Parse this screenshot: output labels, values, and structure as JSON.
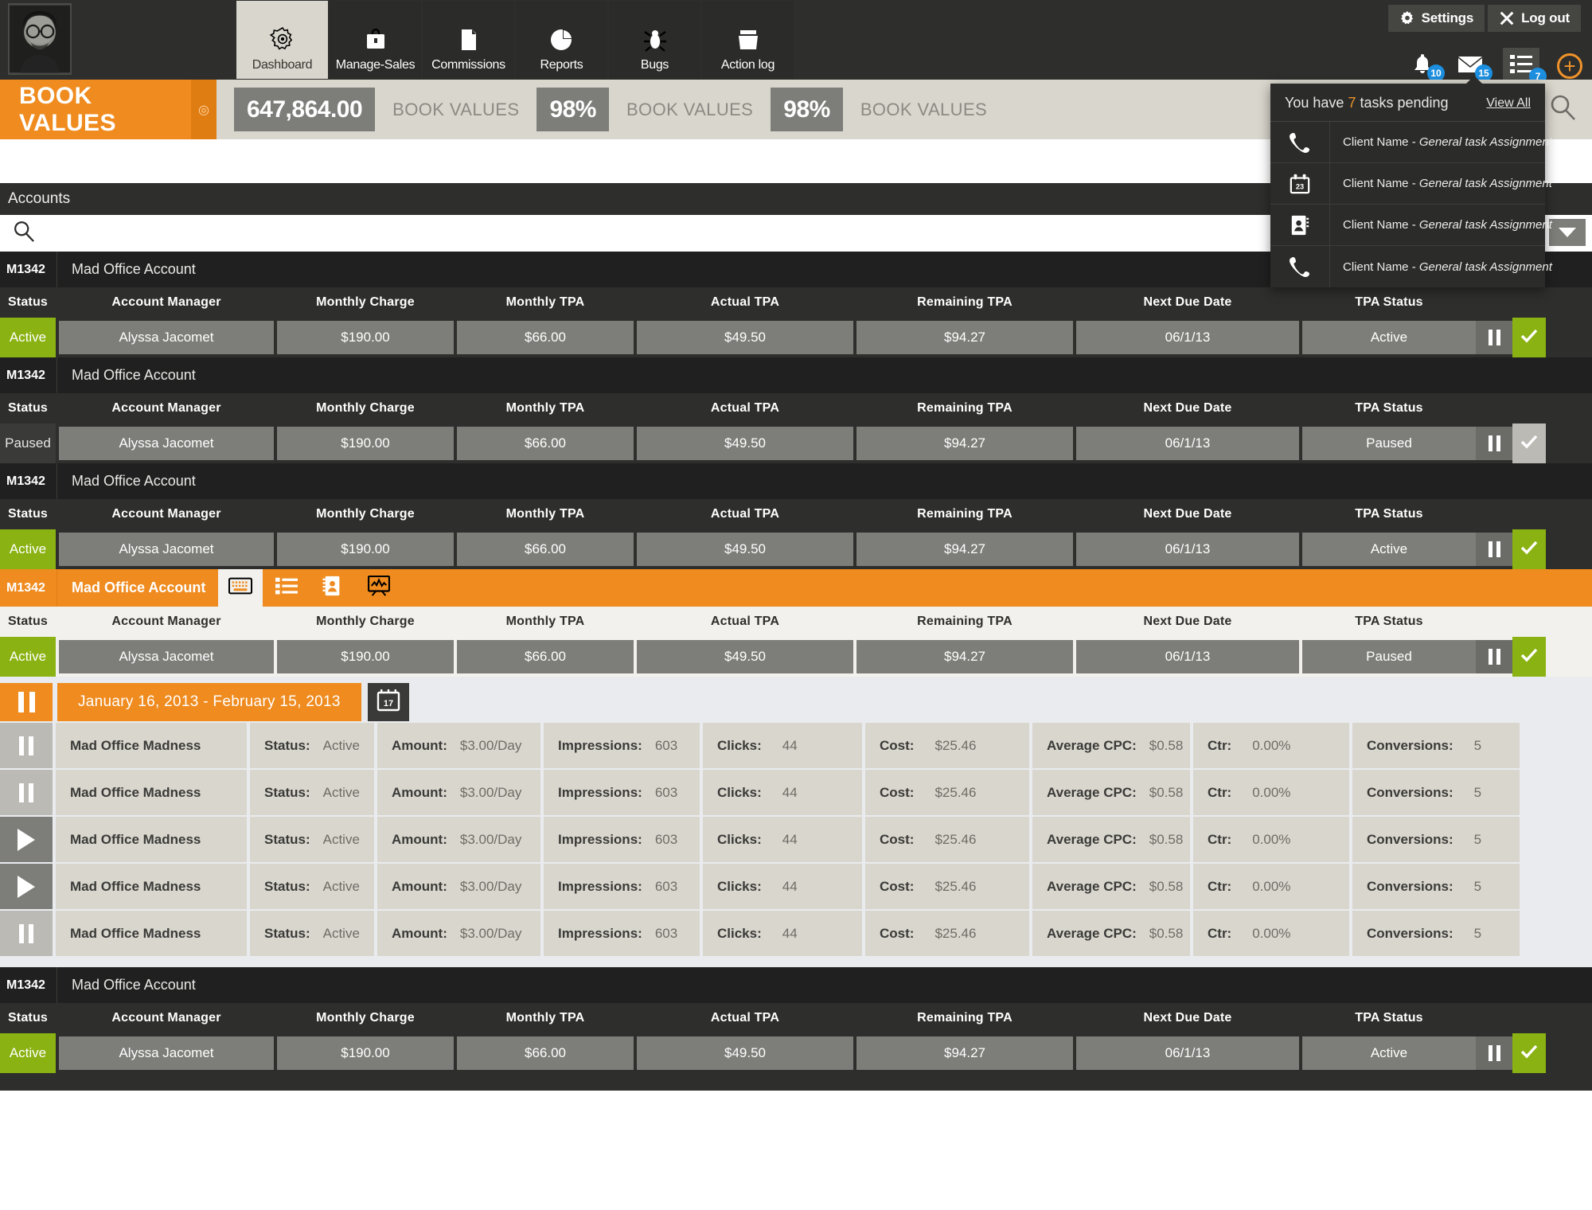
{
  "topnav": {
    "avatar_alt": "user-avatar",
    "tabs": [
      {
        "label": "Dashboard",
        "icon": "gear-icon",
        "active": true
      },
      {
        "label": "Manage-Sales",
        "icon": "briefcase-icon",
        "active": false
      },
      {
        "label": "Commissions",
        "icon": "document-icon",
        "active": false
      },
      {
        "label": "Reports",
        "icon": "pie-chart-icon",
        "active": false
      },
      {
        "label": "Bugs",
        "icon": "bug-icon",
        "active": false
      },
      {
        "label": "Action log",
        "icon": "folder-icon",
        "active": false
      }
    ],
    "settings_label": "Settings",
    "logout_label": "Log out",
    "notifications": {
      "bell_count": "10",
      "mail_count": "15",
      "tasks_count": "7"
    },
    "add_label": "+"
  },
  "tasks_panel": {
    "heading_prefix": "You have",
    "count": "7",
    "heading_suffix": "tasks pending",
    "view_all": "View All",
    "items": [
      {
        "icon": "phone-icon",
        "client": "Client Name - ",
        "task": "General task Assignment"
      },
      {
        "icon": "calendar-icon",
        "client": "Client Name - ",
        "task": "General task Assignment"
      },
      {
        "icon": "contact-book-icon",
        "client": "Client Name - ",
        "task": "General task Assignment"
      },
      {
        "icon": "phone-icon",
        "client": "Client Name - ",
        "task": "General task Assignment"
      }
    ]
  },
  "kpi_strip": {
    "title": "BOOK VALUES",
    "items": [
      {
        "value": "647,864.00",
        "label": "BOOK VALUES"
      },
      {
        "value": "98%",
        "label": "BOOK VALUES"
      },
      {
        "value": "98%",
        "label": "BOOK VALUES"
      }
    ]
  },
  "accounts_section": {
    "heading": "Accounts",
    "search_placeholder": "",
    "search_value": ""
  },
  "columns": [
    "Status",
    "Account Manager",
    "Monthly Charge",
    "Monthly TPA",
    "Actual TPA",
    "Remaining TPA",
    "Next Due Date",
    "TPA Status"
  ],
  "accounts": [
    {
      "code": "M1342",
      "name": "Mad Office Account",
      "selected": false,
      "status": "Active",
      "manager": "Alyssa Jacomet",
      "monthly_charge": "$190.00",
      "monthly_tpa": "$66.00",
      "actual_tpa": "$49.50",
      "remaining_tpa": "$94.27",
      "next_due": "06/1/13",
      "tpa_status": "Active",
      "check_green": true
    },
    {
      "code": "M1342",
      "name": "Mad Office Account",
      "selected": false,
      "status": "Paused",
      "manager": "Alyssa Jacomet",
      "monthly_charge": "$190.00",
      "monthly_tpa": "$66.00",
      "actual_tpa": "$49.50",
      "remaining_tpa": "$94.27",
      "next_due": "06/1/13",
      "tpa_status": "Paused",
      "check_green": false
    },
    {
      "code": "M1342",
      "name": "Mad Office Account",
      "selected": false,
      "status": "Active",
      "manager": "Alyssa Jacomet",
      "monthly_charge": "$190.00",
      "monthly_tpa": "$66.00",
      "actual_tpa": "$49.50",
      "remaining_tpa": "$94.27",
      "next_due": "06/1/13",
      "tpa_status": "Active",
      "check_green": true
    },
    {
      "code": "M1342",
      "name": "Mad Office Account",
      "selected": true,
      "status": "Active",
      "manager": "Alyssa Jacomet",
      "monthly_charge": "$190.00",
      "monthly_tpa": "$66.00",
      "actual_tpa": "$49.50",
      "remaining_tpa": "$94.27",
      "next_due": "06/1/13",
      "tpa_status": "Paused",
      "check_green": true
    },
    {
      "code": "M1342",
      "name": "Mad Office Account",
      "selected": false,
      "status": "Active",
      "manager": "Alyssa Jacomet",
      "monthly_charge": "$190.00",
      "monthly_tpa": "$66.00",
      "actual_tpa": "$49.50",
      "remaining_tpa": "$94.27",
      "next_due": "06/1/13",
      "tpa_status": "Active",
      "check_green": true
    }
  ],
  "account_tabs": [
    {
      "icon": "keyboard-icon",
      "active": true
    },
    {
      "icon": "list-icon",
      "active": false
    },
    {
      "icon": "contact-card-icon",
      "active": false
    },
    {
      "icon": "analytics-icon",
      "active": false
    }
  ],
  "campaign_panel": {
    "date_range": "January 16, 2013 - February 15, 2013",
    "calendar_icon": "calendar-17-icon",
    "labels": {
      "status": "Status:",
      "amount": "Amount:",
      "impressions": "Impressions:",
      "clicks": "Clicks:",
      "cost": "Cost:",
      "avg_cpc": "Average CPC:",
      "ctr": "Ctr:",
      "conversions": "Conversions:"
    },
    "rows": [
      {
        "toggle": "pause",
        "name": "Mad Office Madness",
        "status": "Active",
        "amount": "$3.00/Day",
        "impressions": "603",
        "clicks": "44",
        "cost": "$25.46",
        "avg_cpc": "$0.58",
        "ctr": "0.00%",
        "conversions": "5"
      },
      {
        "toggle": "pause",
        "name": "Mad Office Madness",
        "status": "Active",
        "amount": "$3.00/Day",
        "impressions": "603",
        "clicks": "44",
        "cost": "$25.46",
        "avg_cpc": "$0.58",
        "ctr": "0.00%",
        "conversions": "5"
      },
      {
        "toggle": "play",
        "name": "Mad Office Madness",
        "status": "Active",
        "amount": "$3.00/Day",
        "impressions": "603",
        "clicks": "44",
        "cost": "$25.46",
        "avg_cpc": "$0.58",
        "ctr": "0.00%",
        "conversions": "5"
      },
      {
        "toggle": "play",
        "name": "Mad Office Madness",
        "status": "Active",
        "amount": "$3.00/Day",
        "impressions": "603",
        "clicks": "44",
        "cost": "$25.46",
        "avg_cpc": "$0.58",
        "ctr": "0.00%",
        "conversions": "5"
      },
      {
        "toggle": "pause",
        "name": "Mad Office Madness",
        "status": "Active",
        "amount": "$3.00/Day",
        "impressions": "603",
        "clicks": "44",
        "cost": "$25.46",
        "avg_cpc": "$0.58",
        "ctr": "0.00%",
        "conversions": "5"
      }
    ]
  },
  "colors": {
    "orange": "#ef8b1f",
    "green": "#8ab212",
    "dark": "#2e2e2c",
    "blue_badge": "#1c8fe0",
    "grey_cell": "#7d7d79"
  }
}
